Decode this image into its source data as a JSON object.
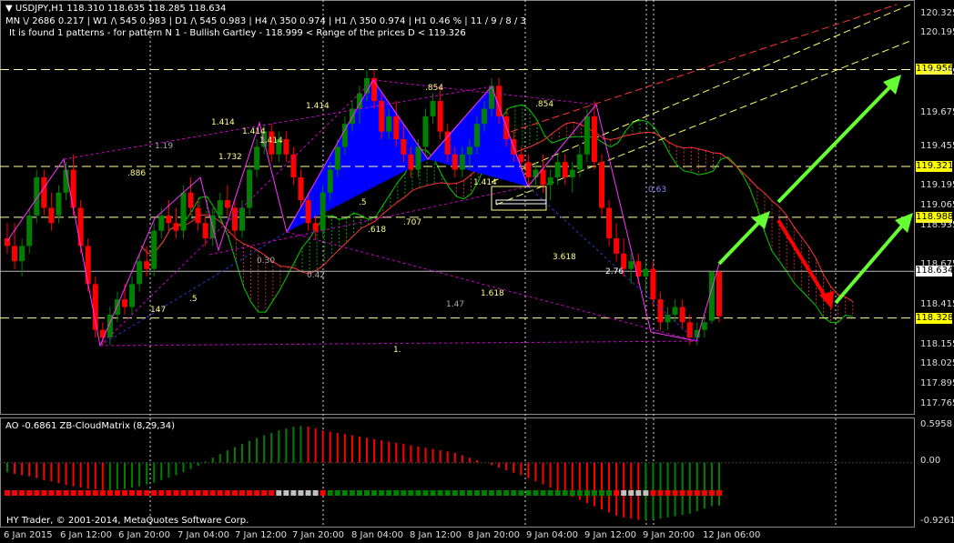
{
  "header": {
    "symbol_line": "USDJPY,H1  118.310 118.635 118.285 118.634",
    "tf_line": "MN \\/ 2686  0.217  |  W1 /\\ 545  0.983  |  D1 /\\ 545  0.983  |  H4 /\\ 350  0.974  |  H1 /\\ 350  0.974  |  H1  0.46 %  |  11 / 9 / 8 / 3",
    "pattern_line": "It is found 1 patterns  -  for pattern N 1 - Bullish Gartley - 118.999 < Range of the prices D < 119.326",
    "dropdown_icon": "triangle-down-icon"
  },
  "indicator": {
    "label": "AO -0.6861  ZB-CloudMatrix (8,29,34)",
    "y_labels": [
      "0.5958",
      "0.00",
      "-0.9261"
    ]
  },
  "copyright": "HY Trader, © 2001-2014, MetaQuotes Software Corp.",
  "price_axis": {
    "labels": [
      "120.325",
      "120.195",
      "119.935",
      "119.675",
      "119.455",
      "119.195",
      "119.065",
      "118.935",
      "118.675",
      "118.415",
      "118.155",
      "118.025",
      "117.895",
      "117.765"
    ],
    "highlights": [
      {
        "value": "119.956",
        "color": "#ffff00"
      },
      {
        "value": "119.321",
        "color": "#ffff00"
      },
      {
        "value": "118.988",
        "color": "#ffff00"
      },
      {
        "value": "118.634",
        "color": "#ffffff"
      },
      {
        "value": "118.328",
        "color": "#ffff00"
      }
    ]
  },
  "time_axis": {
    "labels": [
      "6 Jan 2015",
      "6 Jan 12:00",
      "6 Jan 20:00",
      "7 Jan 04:00",
      "7 Jan 12:00",
      "7 Jan 20:00",
      "8 Jan 04:00",
      "8 Jan 12:00",
      "8 Jan 20:00",
      "9 Jan 04:00",
      "9 Jan 12:00",
      "9 Jan 20:00",
      "12 Jan 06:00"
    ]
  },
  "fib_labels": [
    ".886",
    "1.19",
    "1.414",
    "1.732",
    "1.414",
    "1.414",
    ".854",
    ".854",
    "1.414",
    ".5",
    ".618",
    ".707",
    "1.618",
    "3.618",
    "2.76",
    "0.63",
    "0.30",
    "0.42",
    ".5",
    "1.47",
    "1.",
    "147",
    "1.414"
  ],
  "colors": {
    "bull": "#008000",
    "bear": "#ff0000",
    "doji": "#c0c0c0",
    "pattern_fill": "#0000ff",
    "cloud_green": "#00cc00",
    "cloud_red": "#ff3333",
    "magenta": "#ff00ff",
    "arrow_green": "#66ff33",
    "arrow_red": "#ff0000",
    "level_line": "#ffff99"
  },
  "chart_data": {
    "type": "candlestick",
    "symbol": "USDJPY",
    "timeframe": "H1",
    "ylim": [
      117.7,
      120.4
    ],
    "last_price": 118.634,
    "candles": [
      [
        118.85,
        118.95,
        118.75,
        118.8
      ],
      [
        118.8,
        118.95,
        118.65,
        118.7
      ],
      [
        118.7,
        118.85,
        118.6,
        118.8
      ],
      [
        118.8,
        119.05,
        118.75,
        119.0
      ],
      [
        119.0,
        119.3,
        118.95,
        119.25
      ],
      [
        119.25,
        119.3,
        119.0,
        119.05
      ],
      [
        119.05,
        119.15,
        118.9,
        118.95
      ],
      [
        119.0,
        119.2,
        118.95,
        119.15
      ],
      [
        119.15,
        119.35,
        119.1,
        119.3
      ],
      [
        119.3,
        119.4,
        119.0,
        119.05
      ],
      [
        119.05,
        119.1,
        118.75,
        118.8
      ],
      [
        118.8,
        118.85,
        118.5,
        118.55
      ],
      [
        118.55,
        118.6,
        118.2,
        118.25
      ],
      [
        118.25,
        118.3,
        118.15,
        118.2
      ],
      [
        118.2,
        118.4,
        118.15,
        118.35
      ],
      [
        118.35,
        118.5,
        118.3,
        118.45
      ],
      [
        118.45,
        118.55,
        118.35,
        118.4
      ],
      [
        118.4,
        118.6,
        118.35,
        118.55
      ],
      [
        118.55,
        118.75,
        118.5,
        118.7
      ],
      [
        118.7,
        118.8,
        118.6,
        118.65
      ],
      [
        118.65,
        118.95,
        118.6,
        118.9
      ],
      [
        118.9,
        119.05,
        118.85,
        119.0
      ],
      [
        119.0,
        119.1,
        118.9,
        118.95
      ],
      [
        118.95,
        119.05,
        118.85,
        118.9
      ],
      [
        118.9,
        119.2,
        118.85,
        119.15
      ],
      [
        119.15,
        119.25,
        119.0,
        119.05
      ],
      [
        119.05,
        119.1,
        118.9,
        118.95
      ],
      [
        118.95,
        119.0,
        118.8,
        118.85
      ],
      [
        118.85,
        119.05,
        118.8,
        119.0
      ],
      [
        119.0,
        119.15,
        118.95,
        119.1
      ],
      [
        119.1,
        119.2,
        119.0,
        119.05
      ],
      [
        119.05,
        119.1,
        118.85,
        118.9
      ],
      [
        118.9,
        119.1,
        118.85,
        119.05
      ],
      [
        119.05,
        119.35,
        119.0,
        119.3
      ],
      [
        119.3,
        119.5,
        119.25,
        119.45
      ],
      [
        119.45,
        119.6,
        119.4,
        119.55
      ],
      [
        119.55,
        119.6,
        119.35,
        119.4
      ],
      [
        119.4,
        119.55,
        119.35,
        119.5
      ],
      [
        119.5,
        119.55,
        119.35,
        119.4
      ],
      [
        119.4,
        119.45,
        119.2,
        119.25
      ],
      [
        119.25,
        119.3,
        119.05,
        119.1
      ],
      [
        119.1,
        119.15,
        118.9,
        118.95
      ],
      [
        118.95,
        119.0,
        118.85,
        118.9
      ],
      [
        118.9,
        119.2,
        118.85,
        119.15
      ],
      [
        119.15,
        119.35,
        119.1,
        119.3
      ],
      [
        119.3,
        119.5,
        119.25,
        119.45
      ],
      [
        119.45,
        119.65,
        119.4,
        119.6
      ],
      [
        119.6,
        119.75,
        119.55,
        119.7
      ],
      [
        119.7,
        119.85,
        119.6,
        119.8
      ],
      [
        119.8,
        119.95,
        119.75,
        119.9
      ],
      [
        119.9,
        119.95,
        119.7,
        119.75
      ],
      [
        119.75,
        119.8,
        119.5,
        119.55
      ],
      [
        119.55,
        119.7,
        119.5,
        119.65
      ],
      [
        119.65,
        119.75,
        119.45,
        119.5
      ],
      [
        119.5,
        119.6,
        119.35,
        119.4
      ],
      [
        119.4,
        119.45,
        119.25,
        119.3
      ],
      [
        119.3,
        119.5,
        119.25,
        119.45
      ],
      [
        119.45,
        119.7,
        119.4,
        119.65
      ],
      [
        119.65,
        119.8,
        119.6,
        119.75
      ],
      [
        119.75,
        119.85,
        119.5,
        119.55
      ],
      [
        119.55,
        119.6,
        119.35,
        119.4
      ],
      [
        119.4,
        119.45,
        119.25,
        119.3
      ],
      [
        119.3,
        119.45,
        119.25,
        119.4
      ],
      [
        119.4,
        119.5,
        119.3,
        119.45
      ],
      [
        119.45,
        119.65,
        119.4,
        119.6
      ],
      [
        119.6,
        119.75,
        119.55,
        119.7
      ],
      [
        119.7,
        119.9,
        119.65,
        119.85
      ],
      [
        119.85,
        119.9,
        119.6,
        119.65
      ],
      [
        119.65,
        119.7,
        119.45,
        119.5
      ],
      [
        119.5,
        119.55,
        119.35,
        119.4
      ],
      [
        119.4,
        119.45,
        119.3,
        119.35
      ],
      [
        119.35,
        119.4,
        119.2,
        119.25
      ],
      [
        119.25,
        119.35,
        119.2,
        119.3
      ],
      [
        119.3,
        119.4,
        119.15,
        119.2
      ],
      [
        119.2,
        119.3,
        119.1,
        119.25
      ],
      [
        119.25,
        119.4,
        119.2,
        119.35
      ],
      [
        119.35,
        119.4,
        119.2,
        119.25
      ],
      [
        119.25,
        119.35,
        119.15,
        119.3
      ],
      [
        119.3,
        119.45,
        119.25,
        119.4
      ],
      [
        119.4,
        119.7,
        119.35,
        119.65
      ],
      [
        119.65,
        119.75,
        119.3,
        119.35
      ],
      [
        119.35,
        119.4,
        119.0,
        119.05
      ],
      [
        119.05,
        119.1,
        118.8,
        118.85
      ],
      [
        118.85,
        118.95,
        118.7,
        118.75
      ],
      [
        118.75,
        118.85,
        118.6,
        118.65
      ],
      [
        118.65,
        118.75,
        118.55,
        118.7
      ],
      [
        118.7,
        118.75,
        118.55,
        118.6
      ],
      [
        118.6,
        118.7,
        118.5,
        118.65
      ],
      [
        118.65,
        118.7,
        118.4,
        118.45
      ],
      [
        118.45,
        118.5,
        118.25,
        118.3
      ],
      [
        118.3,
        118.4,
        118.25,
        118.35
      ],
      [
        118.35,
        118.45,
        118.3,
        118.4
      ],
      [
        118.4,
        118.45,
        118.25,
        118.3
      ],
      [
        118.3,
        118.35,
        118.15,
        118.2
      ],
      [
        118.2,
        118.3,
        118.15,
        118.25
      ],
      [
        118.25,
        118.35,
        118.2,
        118.3
      ],
      [
        118.31,
        118.64,
        118.29,
        118.63
      ],
      [
        118.63,
        118.64,
        118.3,
        118.34
      ]
    ],
    "ao": [
      -0.15,
      -0.18,
      -0.2,
      -0.22,
      -0.25,
      -0.28,
      -0.3,
      -0.33,
      -0.36,
      -0.38,
      -0.4,
      -0.42,
      -0.43,
      -0.44,
      -0.44,
      -0.43,
      -0.42,
      -0.4,
      -0.38,
      -0.35,
      -0.32,
      -0.28,
      -0.24,
      -0.2,
      -0.15,
      -0.1,
      -0.05,
      0.02,
      0.08,
      0.14,
      0.2,
      0.25,
      0.3,
      0.35,
      0.4,
      0.44,
      0.48,
      0.52,
      0.55,
      0.58,
      0.59,
      0.58,
      0.55,
      0.52,
      0.5,
      0.48,
      0.46,
      0.44,
      0.42,
      0.4,
      0.38,
      0.36,
      0.34,
      0.32,
      0.3,
      0.28,
      0.26,
      0.24,
      0.22,
      0.2,
      0.18,
      0.16,
      0.12,
      0.08,
      0.04,
      0.0,
      -0.04,
      -0.08,
      -0.12,
      -0.16,
      -0.2,
      -0.25,
      -0.3,
      -0.35,
      -0.4,
      -0.45,
      -0.5,
      -0.55,
      -0.6,
      -0.65,
      -0.7,
      -0.75,
      -0.8,
      -0.85,
      -0.88,
      -0.9,
      -0.92,
      -0.92,
      -0.91,
      -0.9,
      -0.88,
      -0.86,
      -0.84,
      -0.82,
      -0.78,
      -0.74,
      -0.7,
      -0.69
    ],
    "ao_ylim": [
      -0.9261,
      0.5958
    ]
  }
}
